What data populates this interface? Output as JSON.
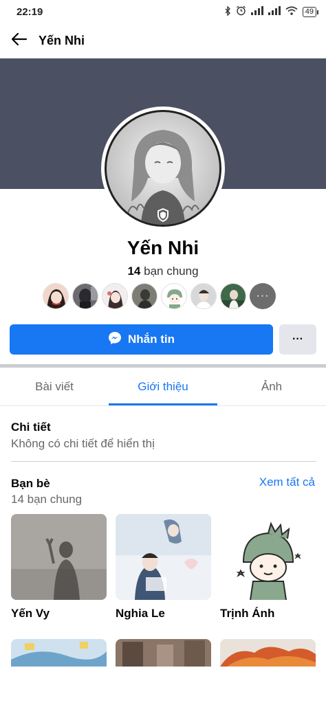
{
  "status_bar": {
    "time": "22:19",
    "battery": "49",
    "icons": [
      "bluetooth-icon",
      "alarm-icon",
      "signal-icon",
      "signal-icon",
      "wifi-icon",
      "battery-icon"
    ]
  },
  "header": {
    "title": "Yến Nhi",
    "back_icon": "arrow-left-icon"
  },
  "profile": {
    "name": "Yến Nhi",
    "mutual_count": "14",
    "mutual_label": "bạn chung",
    "cover_color": "#4b5162",
    "badge_icon": "shield-icon"
  },
  "actions": {
    "message_label": "Nhắn tin",
    "message_icon": "messenger-icon",
    "more_label": "···",
    "accent": "#1877f2"
  },
  "tabs": [
    {
      "label": "Bài viết",
      "active": false
    },
    {
      "label": "Giới thiệu",
      "active": true
    },
    {
      "label": "Ảnh",
      "active": false
    }
  ],
  "details": {
    "title": "Chi tiết",
    "empty_text": "Không có chi tiết để hiển thị"
  },
  "friends": {
    "title": "Bạn bè",
    "subtitle": "14 bạn chung",
    "see_all": "Xem tất cả",
    "items": [
      {
        "name": "Yến Vy"
      },
      {
        "name": "Nghia Le"
      },
      {
        "name": "Trịnh Ánh"
      }
    ]
  }
}
